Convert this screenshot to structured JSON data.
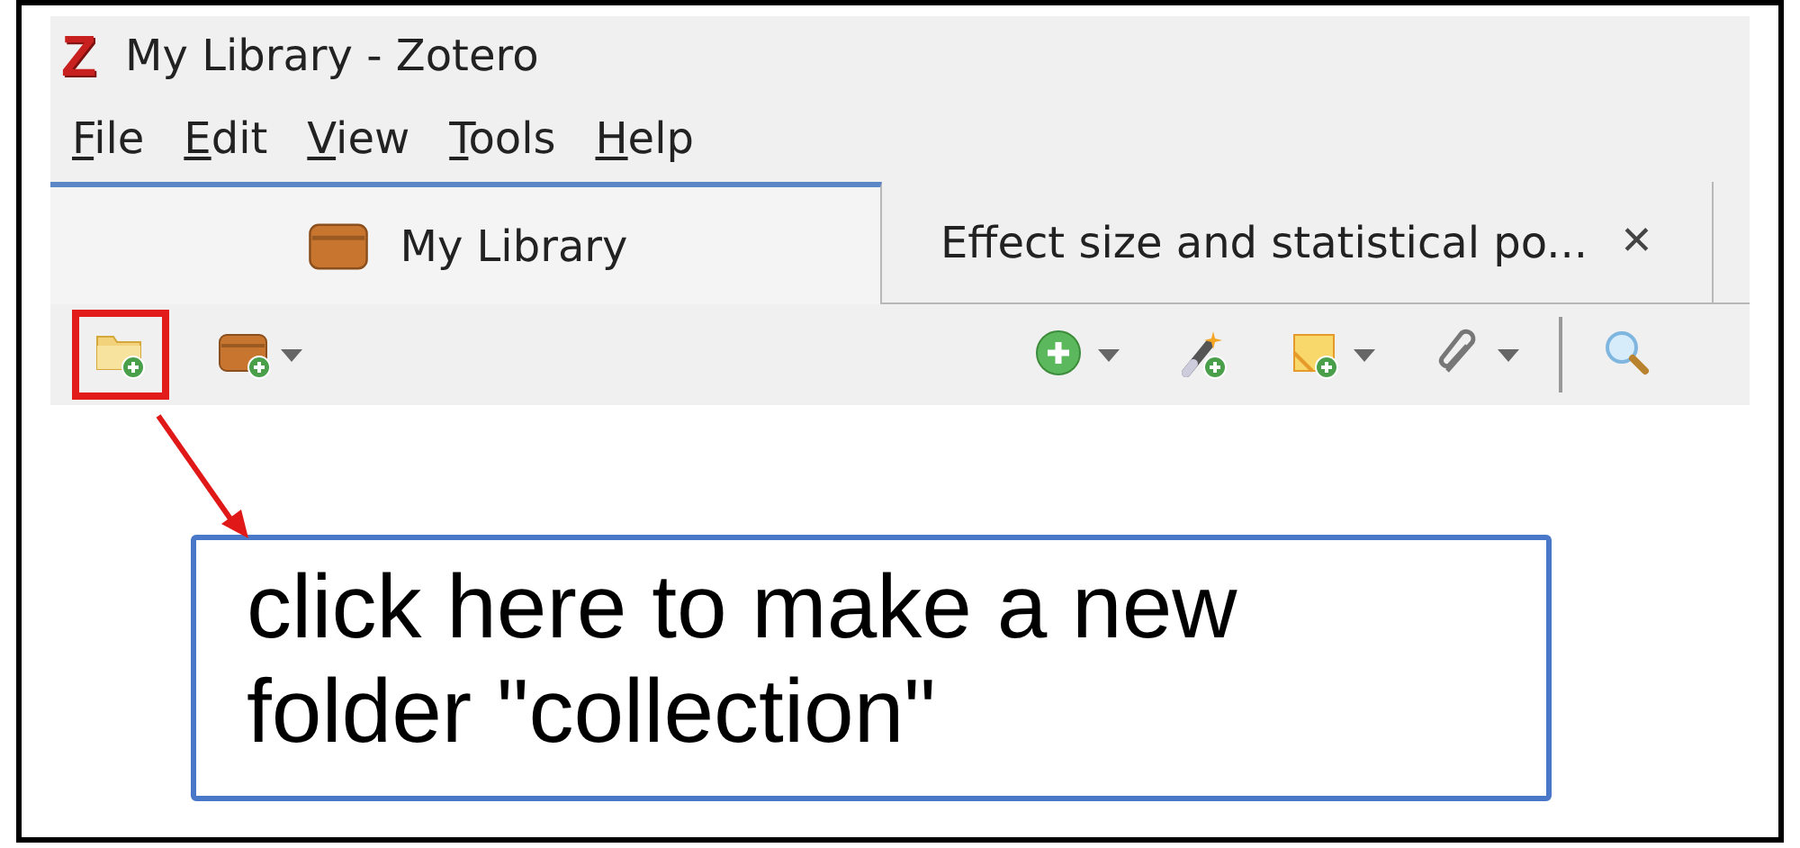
{
  "window": {
    "logo": "Z",
    "title": "My Library - Zotero"
  },
  "menu": [
    "File",
    "Edit",
    "View",
    "Tools",
    "Help"
  ],
  "tabs": [
    {
      "label": "My Library",
      "selected": true,
      "closable": false
    },
    {
      "label": "Effect size and statistical po...",
      "selected": false,
      "closable": true,
      "close": "✕"
    }
  ],
  "toolbar": {
    "left": [
      {
        "kind": "new-collection",
        "dropdown": false,
        "highlighted": true
      },
      {
        "kind": "new-library",
        "dropdown": true,
        "highlighted": false
      }
    ],
    "right": [
      {
        "kind": "new-item",
        "dropdown": true,
        "highlighted": false
      },
      {
        "kind": "add-by-identifier",
        "dropdown": false,
        "highlighted": false
      },
      {
        "kind": "new-note",
        "dropdown": true,
        "highlighted": false
      },
      {
        "kind": "attachment",
        "dropdown": true,
        "highlighted": false
      },
      {
        "kind": "separator"
      },
      {
        "kind": "search",
        "dropdown": false,
        "highlighted": false
      }
    ]
  },
  "callout": {
    "text": "click here to make a new folder \"collection\""
  }
}
